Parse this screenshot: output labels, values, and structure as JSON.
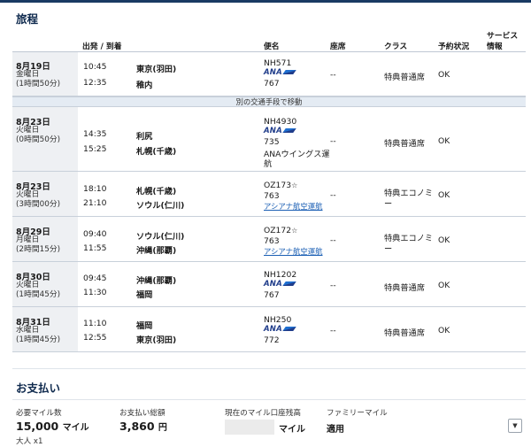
{
  "itinerary": {
    "title": "旅程",
    "headers": {
      "depart_arrive": "出発 / 到着",
      "flight": "便名",
      "seat": "座席",
      "class": "クラス",
      "status": "予約状況",
      "service_line1": "サービス",
      "service_line2": "情報"
    },
    "transfer_notice": "別の交通手段で移動",
    "segments": [
      {
        "date": "8月19日",
        "weekday": "金曜日",
        "duration": "(1時間50分)",
        "dep_time": "10:45",
        "dep_place": "東京(羽田)",
        "arr_time": "12:35",
        "arr_place": "稚内",
        "flight_no": "NH571",
        "airline_logo": "ANA",
        "aircraft": "767",
        "operator_line1": "",
        "operator_line2": "",
        "seat": "--",
        "class_line1": "特典普通席",
        "class_line2": "",
        "status": "OK"
      },
      {
        "date": "8月23日",
        "weekday": "火曜日",
        "duration": "(0時間50分)",
        "dep_time": "14:35",
        "dep_place": "利尻",
        "arr_time": "15:25",
        "arr_place": "札幌(千歳)",
        "flight_no": "NH4930",
        "airline_logo": "ANA",
        "aircraft": "735",
        "operator_line1": "ANAウイングス運",
        "operator_line2": "航",
        "seat": "--",
        "class_line1": "特典普通席",
        "class_line2": "",
        "status": "OK"
      },
      {
        "date": "8月23日",
        "weekday": "火曜日",
        "duration": "(3時間00分)",
        "dep_time": "18:10",
        "dep_place": "札幌(千歳)",
        "arr_time": "21:10",
        "arr_place": "ソウル(仁川)",
        "flight_no": "OZ173",
        "partner_mark": "☆",
        "aircraft": "763",
        "partner_airline": "アシアナ航空運航",
        "seat": "--",
        "class_line1": "特典エコノミ",
        "class_line2": "ー",
        "status": "OK"
      },
      {
        "date": "8月29日",
        "weekday": "月曜日",
        "duration": "(2時間15分)",
        "dep_time": "09:40",
        "dep_place": "ソウル(仁川)",
        "arr_time": "11:55",
        "arr_place": "沖縄(那覇)",
        "flight_no": "OZ172",
        "partner_mark": "☆",
        "aircraft": "763",
        "partner_airline": "アシアナ航空運航",
        "seat": "--",
        "class_line1": "特典エコノミ",
        "class_line2": "ー",
        "status": "OK"
      },
      {
        "date": "8月30日",
        "weekday": "火曜日",
        "duration": "(1時間45分)",
        "dep_time": "09:45",
        "dep_place": "沖縄(那覇)",
        "arr_time": "11:30",
        "arr_place": "福岡",
        "flight_no": "NH1202",
        "airline_logo": "ANA",
        "aircraft": "767",
        "seat": "--",
        "class_line1": "特典普通席",
        "class_line2": "",
        "status": "OK"
      },
      {
        "date": "8月31日",
        "weekday": "水曜日",
        "duration": "(1時間45分)",
        "dep_time": "11:10",
        "dep_place": "福岡",
        "arr_time": "12:55",
        "arr_place": "東京(羽田)",
        "flight_no": "NH250",
        "airline_logo": "ANA",
        "aircraft": "772",
        "seat": "--",
        "class_line1": "特典普通席",
        "class_line2": "",
        "status": "OK"
      }
    ]
  },
  "payment": {
    "title": "お支払い",
    "required_miles_label": "必要マイル数",
    "required_miles_value": "15,000",
    "required_miles_unit": "マイル",
    "passenger_note": "大人 x1",
    "total_label": "お支払い総額",
    "total_value": "3,860",
    "total_unit": "円",
    "balance_label": "現在のマイル口座残高",
    "balance_unit": "マイル",
    "family_label": "ファミリーマイル",
    "family_value": "適用",
    "dropdown_icon": "chevron-down-icon",
    "dropdown_glyph": "▼"
  },
  "colors": {
    "title": "#0f2a4e",
    "link": "#1b5fb4",
    "ana_blue": "#1f3c8a",
    "band": "#e4ebf3"
  }
}
